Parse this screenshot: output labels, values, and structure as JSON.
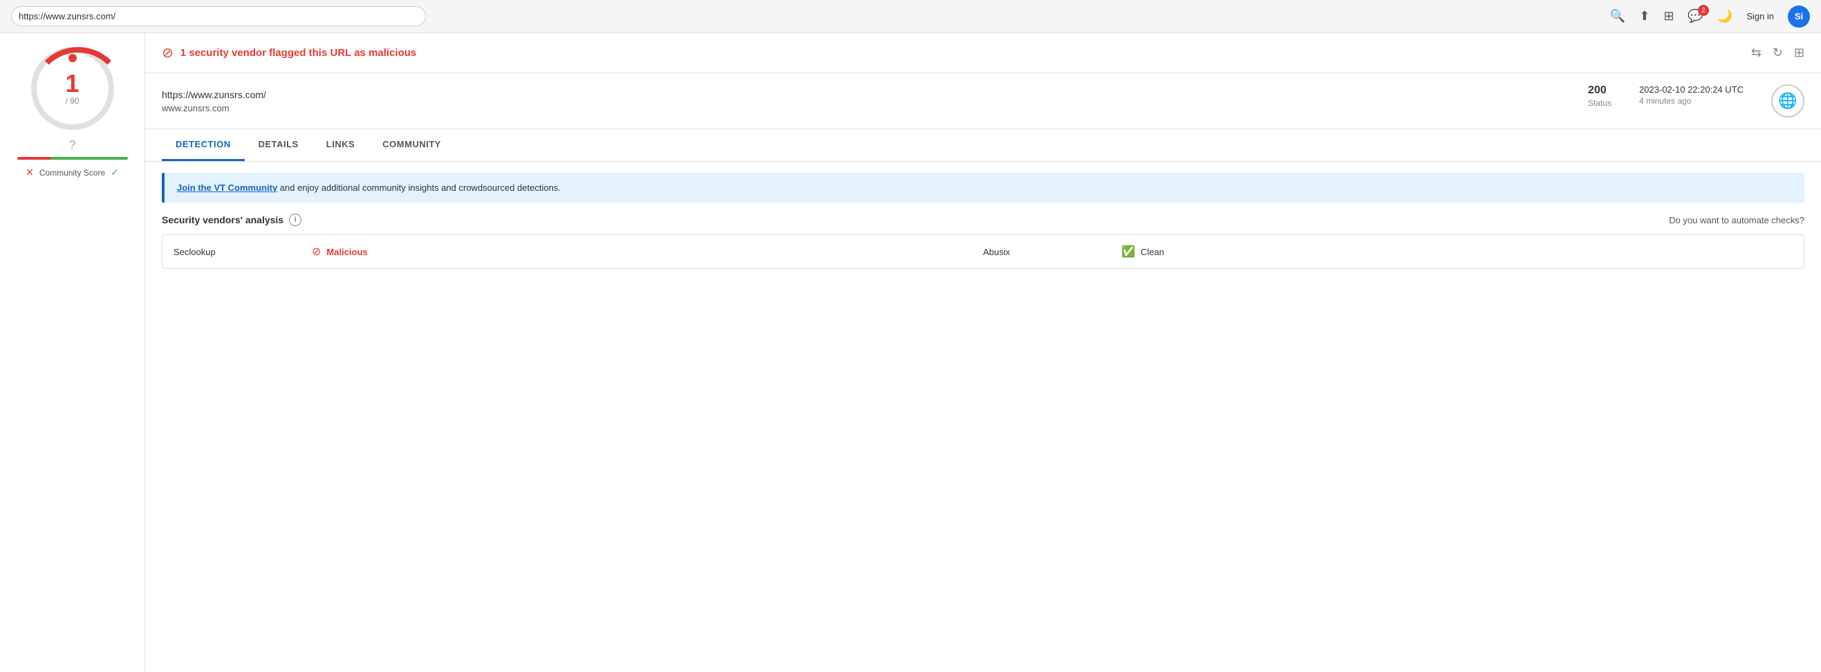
{
  "browser": {
    "address": "https://www.zunsrs.com/",
    "sign_in_label": "Si",
    "badge_count": "2"
  },
  "sidebar": {
    "score_number": "1",
    "score_total": "/ 90",
    "community_score_label": "Community Score",
    "question_mark": "?"
  },
  "alert": {
    "text": "1 security vendor flagged this URL as malicious"
  },
  "url_info": {
    "url": "https://www.zunsrs.com/",
    "domain": "www.zunsrs.com",
    "status_code": "200",
    "status_label": "Status",
    "timestamp": "2023-02-10 22:20:24 UTC",
    "time_ago": "4 minutes ago"
  },
  "tabs": {
    "detection": "DETECTION",
    "details": "DETAILS",
    "links": "LINKS",
    "community": "COMMUNITY"
  },
  "join_banner": {
    "link_text": "Join the VT Community",
    "body_text": " and enjoy additional community insights and crowdsourced detections."
  },
  "security_analysis": {
    "title": "Security vendors' analysis",
    "automate_text": "Do you want to automate checks?",
    "vendors": [
      {
        "name": "Seclookup",
        "status": "Malicious",
        "status_type": "malicious"
      },
      {
        "name": "Abusix",
        "status": "Clean",
        "status_type": "clean"
      }
    ]
  },
  "icons": {
    "search": "🔍",
    "upload": "⬆",
    "grid": "⊞",
    "chat": "💬",
    "moon": "🌙",
    "compare": "⇆",
    "refresh": "↻",
    "qr": "⊞",
    "globe": "🌐"
  }
}
